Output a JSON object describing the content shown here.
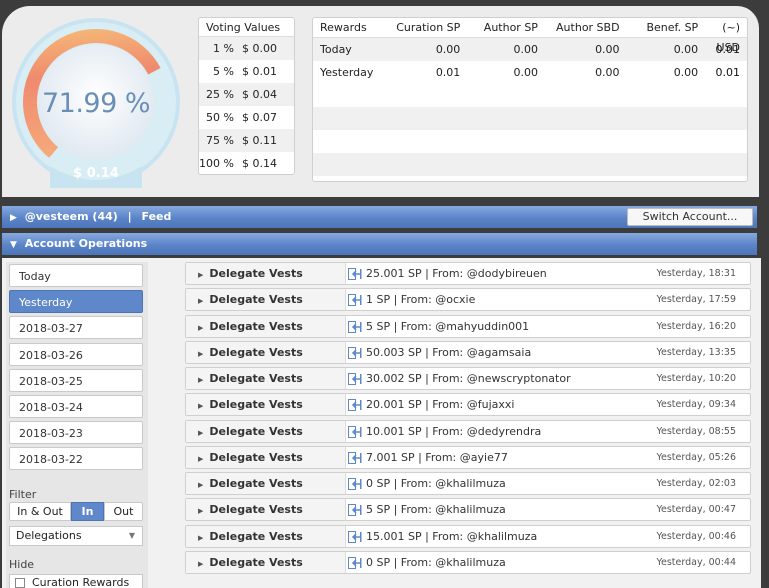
{
  "gauge": {
    "percent_text": "71.99 %",
    "money_text": "$ 0.14",
    "fill_percent": 71.99,
    "colors": {
      "ring_start": "#f7c97a",
      "ring_mid": "#f08a6e",
      "ring_end": "#e8e48a",
      "outer": "#c8e4f0",
      "text": "#6a8fb5"
    }
  },
  "voting": {
    "title": "Voting Values",
    "rows": [
      {
        "pct": "1 %",
        "usd": "$ 0.00"
      },
      {
        "pct": "5 %",
        "usd": "$ 0.01"
      },
      {
        "pct": "25 %",
        "usd": "$ 0.04"
      },
      {
        "pct": "50 %",
        "usd": "$ 0.07"
      },
      {
        "pct": "75 %",
        "usd": "$ 0.11"
      },
      {
        "pct": "100 %",
        "usd": "$ 0.14"
      }
    ]
  },
  "rewards": {
    "headers": [
      "Rewards",
      "Curation SP",
      "Author SP",
      "Author SBD",
      "Benef. SP",
      "(~) USD"
    ],
    "rows": [
      {
        "label": "Today",
        "values": [
          "0.00",
          "0.00",
          "0.00",
          "0.00",
          "0.01"
        ]
      },
      {
        "label": "Yesterday",
        "values": [
          "0.01",
          "0.00",
          "0.00",
          "0.00",
          "0.01"
        ]
      }
    ]
  },
  "account_bar": {
    "account": "@vesteem (44)",
    "separator": "|",
    "feed": "Feed",
    "switch_label": "Switch Account..."
  },
  "ops_bar": {
    "title": "Account Operations"
  },
  "sidebar": {
    "days": [
      "Today",
      "Yesterday",
      "2018-03-27",
      "2018-03-26",
      "2018-03-25",
      "2018-03-24",
      "2018-03-23",
      "2018-03-22"
    ],
    "active_day": "Yesterday",
    "filter_label": "Filter",
    "filter_options": [
      "In & Out",
      "In",
      "Out"
    ],
    "filter_selected": "In",
    "select_value": "Delegations",
    "hide_label": "Hide",
    "hide_option": "Curation Rewards"
  },
  "operations": [
    {
      "type": "Delegate Vests",
      "desc": "25.001 SP | From: @dodybireuen",
      "time": "Yesterday, 18:31"
    },
    {
      "type": "Delegate Vests",
      "desc": "1 SP | From: @ocxie",
      "time": "Yesterday, 17:59"
    },
    {
      "type": "Delegate Vests",
      "desc": "5 SP | From: @mahyuddin001",
      "time": "Yesterday, 16:20"
    },
    {
      "type": "Delegate Vests",
      "desc": "50.003 SP | From: @agamsaia",
      "time": "Yesterday, 13:35"
    },
    {
      "type": "Delegate Vests",
      "desc": "30.002 SP | From: @newscryptonator",
      "time": "Yesterday, 10:20"
    },
    {
      "type": "Delegate Vests",
      "desc": "20.001 SP | From: @fujaxxi",
      "time": "Yesterday, 09:34"
    },
    {
      "type": "Delegate Vests",
      "desc": "10.001 SP | From: @dedyrendra",
      "time": "Yesterday, 08:55"
    },
    {
      "type": "Delegate Vests",
      "desc": "7.001 SP | From: @ayie77",
      "time": "Yesterday, 05:26"
    },
    {
      "type": "Delegate Vests",
      "desc": "0 SP | From: @khalilmuza",
      "time": "Yesterday, 02:03"
    },
    {
      "type": "Delegate Vests",
      "desc": "5 SP | From: @khalilmuza",
      "time": "Yesterday, 00:47"
    },
    {
      "type": "Delegate Vests",
      "desc": "15.001 SP | From: @khalilmuza",
      "time": "Yesterday, 00:46"
    },
    {
      "type": "Delegate Vests",
      "desc": "0 SP | From: @khalilmuza",
      "time": "Yesterday, 00:44"
    }
  ]
}
